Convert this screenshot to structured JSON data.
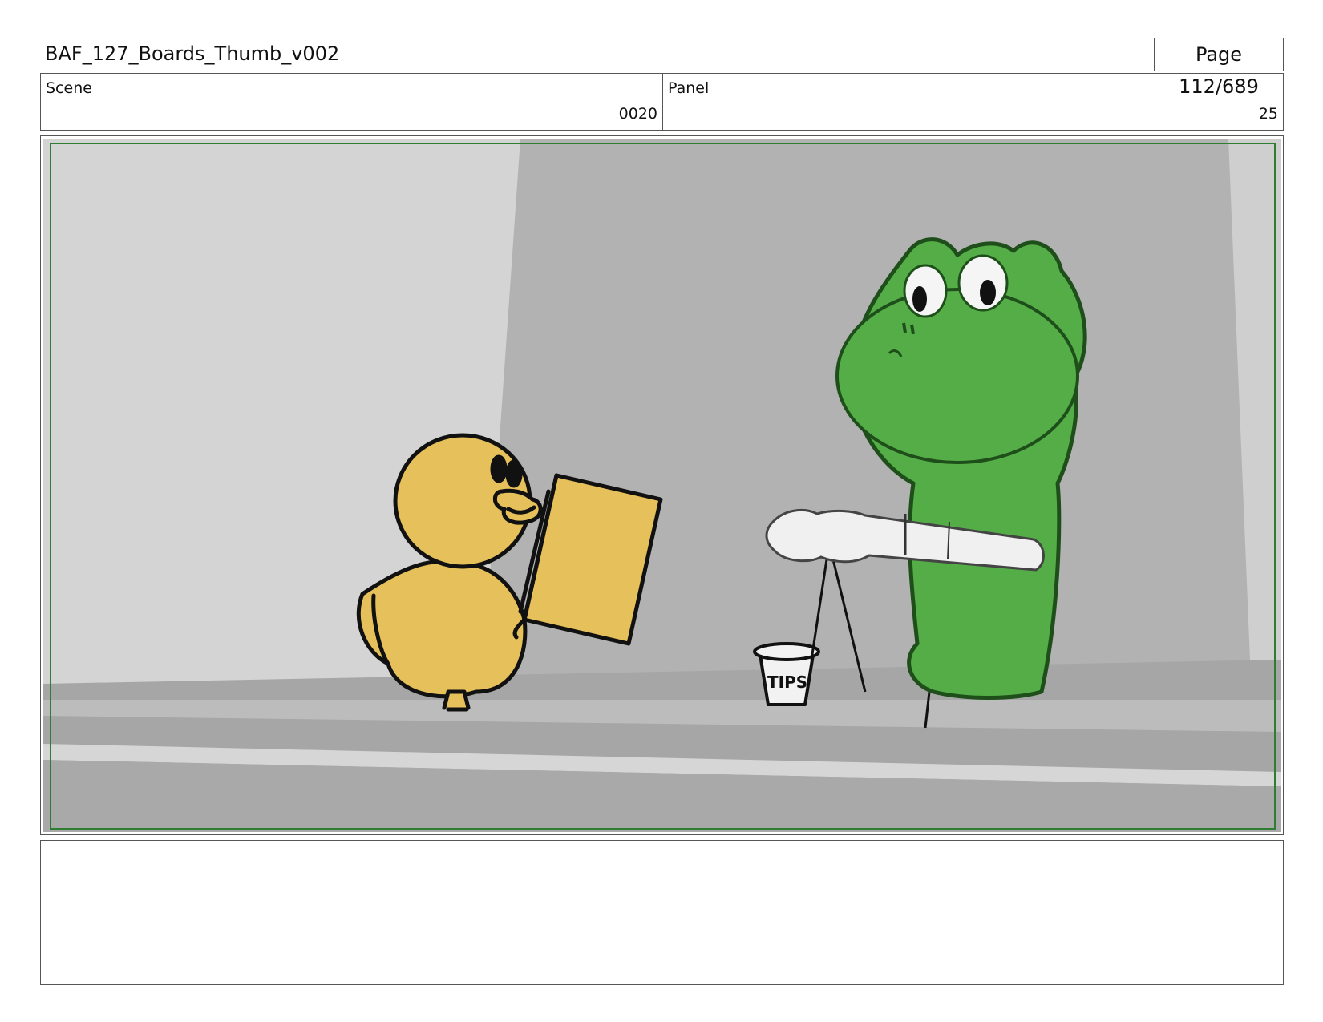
{
  "header": {
    "title": "BAF_127_Boards_Thumb_v002",
    "page": "Page 112/689"
  },
  "info": {
    "scene_label": "Scene",
    "scene_value": "0020",
    "panel_label": "Panel",
    "panel_value": "25"
  },
  "frame": {
    "cup_text": "TIPS",
    "colors": {
      "duck": "#e6c05a",
      "frog": "#55ad48",
      "wall": "#b2b2b2",
      "floor": "#a9a9a9",
      "safe_border": "#2e7d32"
    }
  },
  "notes": {
    "text": ""
  }
}
